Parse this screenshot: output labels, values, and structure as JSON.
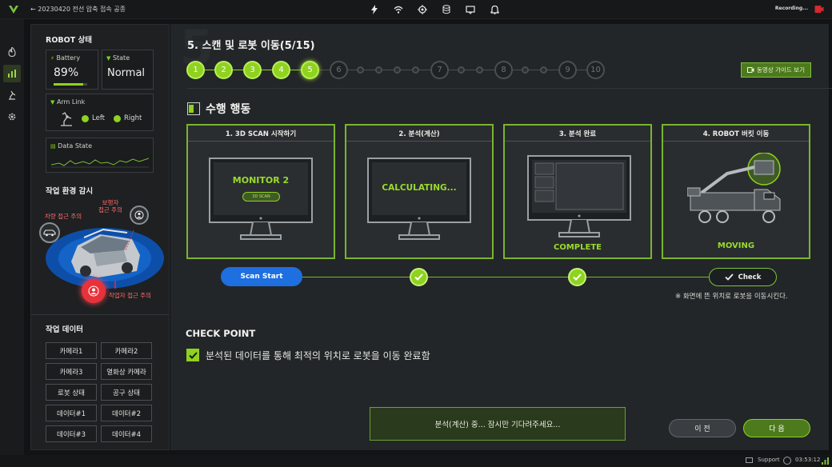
{
  "topbar": {
    "title": "←  20230420 전선 압축 접속 공종",
    "recording": "Recording...",
    "icons": [
      "lightning-icon",
      "wifi-icon",
      "gps-icon",
      "database-icon",
      "message-icon",
      "bell-icon"
    ]
  },
  "rail": {
    "icons": [
      "fire-icon",
      "chart-icon",
      "robot-arm-icon",
      "gear-icon"
    ],
    "active_index": 1
  },
  "robot_status": {
    "title": "ROBOT 상태",
    "battery_label": "Battery",
    "battery_value": "89%",
    "battery_level": 0.89,
    "state_label": "State",
    "state_value": "Normal",
    "armlink_label": "Arm Link",
    "left_label": "Left",
    "right_label": "Right",
    "datastate_label": "Data State"
  },
  "environment": {
    "title": "작업 환경 감시",
    "vehicle_warning": "차량 접근 주의",
    "pedestrian_warning": "보행자\n접근 주의",
    "worker_warning": "작업자 접근 주의"
  },
  "work_data": {
    "title": "작업 데이터",
    "buttons": [
      "카메라1",
      "카메라2",
      "카메라3",
      "열화상 카메라",
      "로봇 상태",
      "공구 상태",
      "데이터#1",
      "데이터#2",
      "데이터#3",
      "데이터#4"
    ]
  },
  "main": {
    "step_title": "5. 스캔 및 로봇 이동(5/15)",
    "steps_major": [
      "1",
      "2",
      "3",
      "4",
      "5",
      "6",
      "7",
      "8",
      "9",
      "10"
    ],
    "current_step": 5,
    "guide_button": "동영상 가이드 보기",
    "section_title": "수행 행동",
    "panels": [
      {
        "header": "1. 3D SCAN 시작하기",
        "screen_text": "MONITOR 2",
        "sub_pill": "3D SCAN"
      },
      {
        "header": "2. 분석(계산)",
        "screen_text": "CALCULATING..."
      },
      {
        "header": "3. 분석 완료",
        "caption": "COMPLETE"
      },
      {
        "header": "4. ROBOT 버킷 이동",
        "caption": "MOVING"
      }
    ],
    "scan_start": "Scan Start",
    "check_label": "Check",
    "note": "※ 화면에 뜬 위치로 로봇을 이동시킨다.",
    "checkpoint_title": "CHECK POINT",
    "checkpoint_item": "분석된 데이터를 통해 최적의 위치로 로봇을 이동 완료함",
    "status_message": "분석(계산) 중... 잠시만 기다려주세요...",
    "prev_button": "이  전",
    "next_button": "다  음"
  },
  "footer": {
    "support": "Support",
    "time": "03:53:12"
  },
  "colors": {
    "accent": "#8fd21f",
    "danger": "#e8323a",
    "scan_button": "#1e6fe0",
    "background": "#232628"
  }
}
